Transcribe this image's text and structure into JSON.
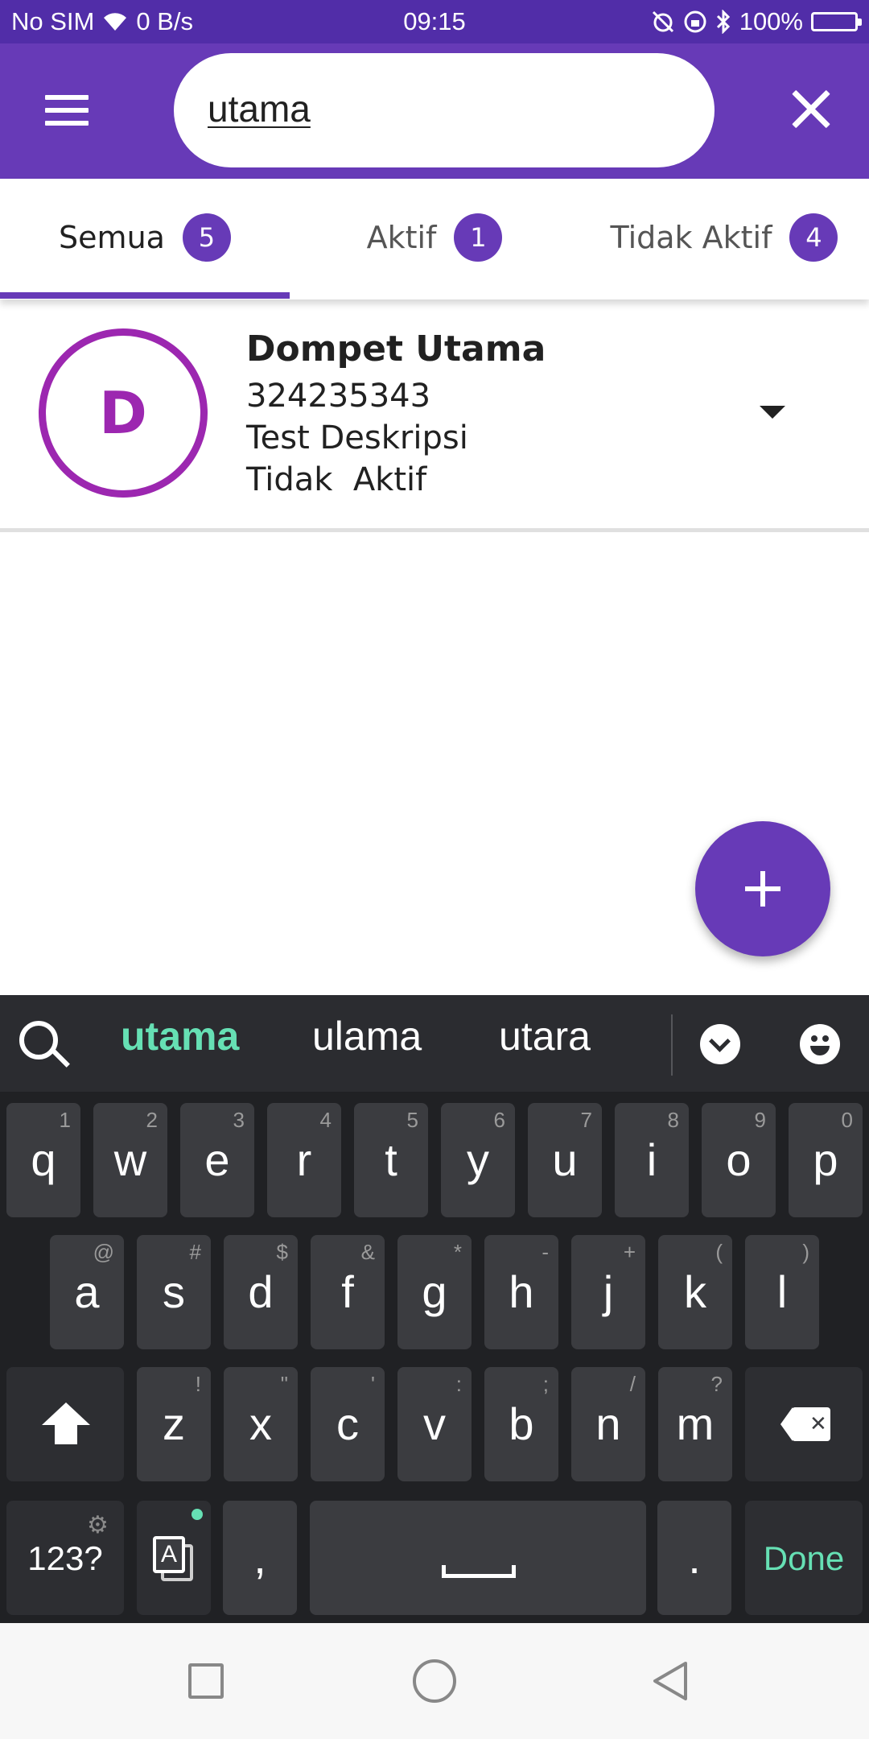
{
  "status_bar": {
    "carrier": "No SIM",
    "net_speed": "0 B/s",
    "time": "09:15",
    "battery": "100%",
    "icons": [
      "wifi-icon",
      "alarm-off-icon",
      "rotation-lock-icon",
      "bluetooth-icon",
      "battery-icon"
    ]
  },
  "app_bar": {
    "search_value": "utama",
    "icons": [
      "menu-icon",
      "close-icon"
    ]
  },
  "tabs": [
    {
      "label": "Semua",
      "count": "5",
      "active": true
    },
    {
      "label": "Aktif",
      "count": "1",
      "active": false
    },
    {
      "label": "Tidak Aktif",
      "count": "4",
      "active": false
    }
  ],
  "wallet": {
    "avatar_letter": "D",
    "name": "Dompet Utama",
    "number": "324235343",
    "description": "Test Deskripsi",
    "status": "Tidak  Aktif"
  },
  "keyboard": {
    "suggestions": [
      "utama",
      "ulama",
      "utara"
    ],
    "row1": [
      {
        "key": "q",
        "hint": "1"
      },
      {
        "key": "w",
        "hint": "2"
      },
      {
        "key": "e",
        "hint": "3"
      },
      {
        "key": "r",
        "hint": "4"
      },
      {
        "key": "t",
        "hint": "5"
      },
      {
        "key": "y",
        "hint": "6"
      },
      {
        "key": "u",
        "hint": "7"
      },
      {
        "key": "i",
        "hint": "8"
      },
      {
        "key": "o",
        "hint": "9"
      },
      {
        "key": "p",
        "hint": "0"
      }
    ],
    "row2": [
      {
        "key": "a",
        "hint": "@"
      },
      {
        "key": "s",
        "hint": "#"
      },
      {
        "key": "d",
        "hint": "$"
      },
      {
        "key": "f",
        "hint": "&"
      },
      {
        "key": "g",
        "hint": "*"
      },
      {
        "key": "h",
        "hint": "-"
      },
      {
        "key": "j",
        "hint": "+"
      },
      {
        "key": "k",
        "hint": "("
      },
      {
        "key": "l",
        "hint": ")"
      }
    ],
    "row3": [
      {
        "key": "z",
        "hint": "!"
      },
      {
        "key": "x",
        "hint": "\""
      },
      {
        "key": "c",
        "hint": "'"
      },
      {
        "key": "v",
        "hint": ":"
      },
      {
        "key": "b",
        "hint": ";"
      },
      {
        "key": "n",
        "hint": "/"
      },
      {
        "key": "m",
        "hint": "?"
      }
    ],
    "numbers_label": "123?",
    "lang_label": "A",
    "comma": ",",
    "period": ".",
    "done_label": "Done"
  },
  "colors": {
    "primary": "#673ab7",
    "status_bar": "#512da8",
    "avatar_ring": "#9c27b0",
    "keyboard_accent": "#66e0b4"
  }
}
